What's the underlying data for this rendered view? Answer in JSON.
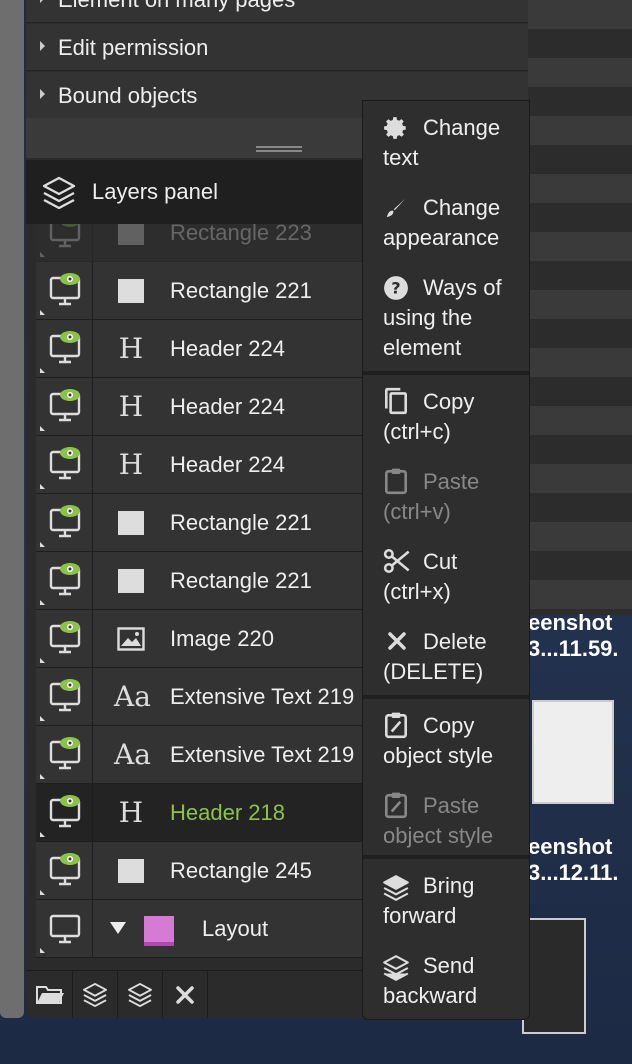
{
  "accordion": [
    {
      "label": "Element on many pages"
    },
    {
      "label": "Edit permission"
    },
    {
      "label": "Bound objects"
    }
  ],
  "layers_panel": {
    "title": "Layers panel"
  },
  "layers": [
    {
      "type": "rect",
      "name": "Rectangle 223",
      "visible": true,
      "dimmed": true
    },
    {
      "type": "rect",
      "name": "Rectangle 221",
      "visible": true
    },
    {
      "type": "header",
      "name": "Header 224",
      "visible": true
    },
    {
      "type": "header",
      "name": "Header 224",
      "visible": true
    },
    {
      "type": "header",
      "name": "Header 224",
      "visible": true
    },
    {
      "type": "rect",
      "name": "Rectangle 221",
      "visible": true
    },
    {
      "type": "rect",
      "name": "Rectangle 221",
      "visible": true
    },
    {
      "type": "image",
      "name": "Image 220",
      "visible": true
    },
    {
      "type": "text",
      "name": "Extensive Text 219",
      "visible": true
    },
    {
      "type": "text",
      "name": "Extensive Text 219",
      "visible": true
    },
    {
      "type": "header",
      "name": "Header 218",
      "visible": true,
      "selected": true
    },
    {
      "type": "rect",
      "name": "Rectangle 245",
      "visible": true
    },
    {
      "type": "layout",
      "name": "Layout",
      "visible": false
    }
  ],
  "type_glyphs": {
    "header": "H",
    "text": "Aa"
  },
  "context_menu": {
    "change_text": [
      "Change",
      "text"
    ],
    "change_appearance": [
      "Change",
      "appearance"
    ],
    "ways_of_using": [
      "Ways of",
      "using the",
      "element"
    ],
    "copy": [
      "Copy",
      "(ctrl+c)"
    ],
    "paste": [
      "Paste",
      "(ctrl+v)"
    ],
    "cut": [
      "Cut",
      "(ctrl+x)"
    ],
    "delete": [
      "Delete",
      "(DELETE)"
    ],
    "copy_style": [
      "Copy",
      "object style"
    ],
    "paste_style": [
      "Paste",
      "object style"
    ],
    "bring_forward": [
      "Bring",
      "forward"
    ],
    "send_backward": [
      "Send",
      "backward"
    ]
  },
  "desktop": {
    "screenshot1": [
      "eenshot",
      "3...11.59."
    ],
    "screenshot2": [
      "eenshot",
      "3...12.11."
    ]
  },
  "colors": {
    "accent_green": "#8bc34a",
    "layout_pink": "#d67ad6"
  }
}
